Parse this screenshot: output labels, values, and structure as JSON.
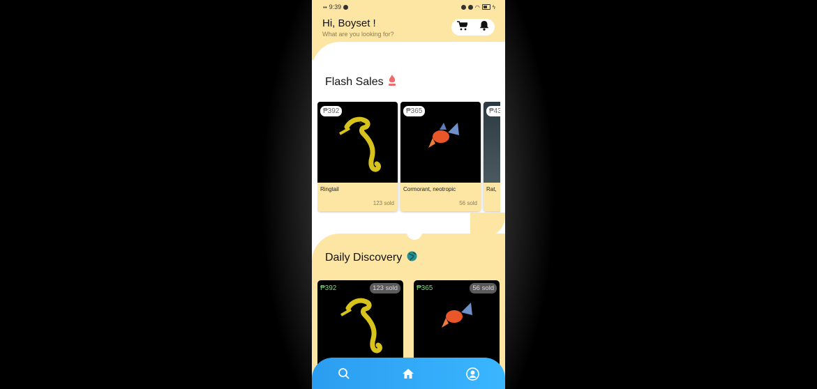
{
  "status_bar": {
    "time": "9:39"
  },
  "header": {
    "greeting": "Hi, Boyset !",
    "subtitle": "What are you looking for?"
  },
  "icons": {
    "cart": "cart-icon",
    "bell": "bell-icon",
    "flame": "flame-icon",
    "globe": "globe-icon",
    "search": "search-icon",
    "home": "home-icon",
    "profile": "profile-icon"
  },
  "flash_sales": {
    "title": "Flash Sales",
    "items": [
      {
        "price": "₱392",
        "name": "Ringtail",
        "sold": "123 sold"
      },
      {
        "price": "₱365",
        "name": "Cormorant, neotropic",
        "sold": "56 sold"
      },
      {
        "price": "₱43",
        "name": "Rat, ",
        "sold": ""
      }
    ]
  },
  "daily_discovery": {
    "title": "Daily Discovery",
    "items": [
      {
        "price": "₱392",
        "sold": "123 sold"
      },
      {
        "price": "₱365",
        "sold": "56 sold"
      }
    ]
  },
  "colors": {
    "header_bg": "#fde6a3",
    "nav_bg": "#2b9df0",
    "price_green": "#7dd87d"
  }
}
